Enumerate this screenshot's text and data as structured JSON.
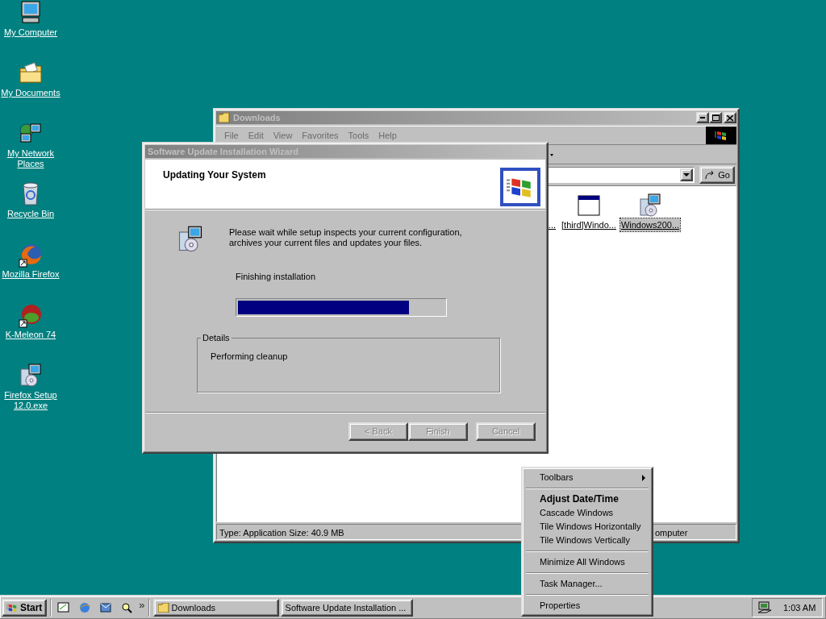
{
  "desktop_icons": [
    {
      "label": "My Computer",
      "kind": "computer"
    },
    {
      "label": "My Documents",
      "kind": "documents"
    },
    {
      "label": "My Network Places",
      "kind": "network"
    },
    {
      "label": "Recycle Bin",
      "kind": "recycle"
    },
    {
      "label": "Mozilla Firefox",
      "kind": "firefox"
    },
    {
      "label": "K-Meleon 74",
      "kind": "kmeleon"
    },
    {
      "label": "Firefox Setup 12.0.exe",
      "kind": "setup"
    }
  ],
  "explorer": {
    "title": "Downloads",
    "menu": [
      "File",
      "Edit",
      "View",
      "Favorites",
      "Tools",
      "Help"
    ],
    "go_button": "Go",
    "files": [
      {
        "label": "...",
        "selected": false
      },
      {
        "label": "[third]Windo...",
        "kind": "window",
        "selected": false
      },
      {
        "label": "Windows200...",
        "kind": "setup",
        "selected": true
      }
    ],
    "status_left": "Type: Application Size: 40.9 MB",
    "status_right": "omputer"
  },
  "wizard": {
    "title": "Software Update Installation Wizard",
    "heading": "Updating Your System",
    "description": "Please wait while setup inspects your current configuration, archives your current files and updates your files.",
    "status": "Finishing installation",
    "progress": {
      "level": 0.83
    },
    "details_label": "Details",
    "details_text": "Performing cleanup",
    "buttons": [
      {
        "label": "< Back",
        "disabled": true
      },
      {
        "label": "Finish",
        "disabled": true
      },
      {
        "label": "Cancel",
        "disabled": true
      }
    ]
  },
  "context_menu": [
    {
      "kind": "submenu",
      "label": "Toolbars"
    },
    {
      "kind": "separator"
    },
    {
      "kind": "item",
      "label": "Adjust Date/Time",
      "default": true
    },
    {
      "kind": "item",
      "label": "Cascade Windows",
      "default": false
    },
    {
      "kind": "item",
      "label": "Tile Windows Horizontally",
      "default": false
    },
    {
      "kind": "item",
      "label": "Tile Windows Vertically",
      "default": false
    },
    {
      "kind": "separator"
    },
    {
      "kind": "item",
      "label": "Minimize All Windows",
      "default": false
    },
    {
      "kind": "separator"
    },
    {
      "kind": "item",
      "label": "Task Manager...",
      "default": false
    },
    {
      "kind": "separator"
    },
    {
      "kind": "item",
      "label": "Properties",
      "default": false
    }
  ],
  "taskbar": {
    "start": "Start",
    "chevron": "»",
    "tasks": [
      {
        "label": "Downloads",
        "selected": false
      },
      {
        "label": "Software Update Installation ...",
        "selected": false
      }
    ],
    "clock": "1:03 AM"
  }
}
